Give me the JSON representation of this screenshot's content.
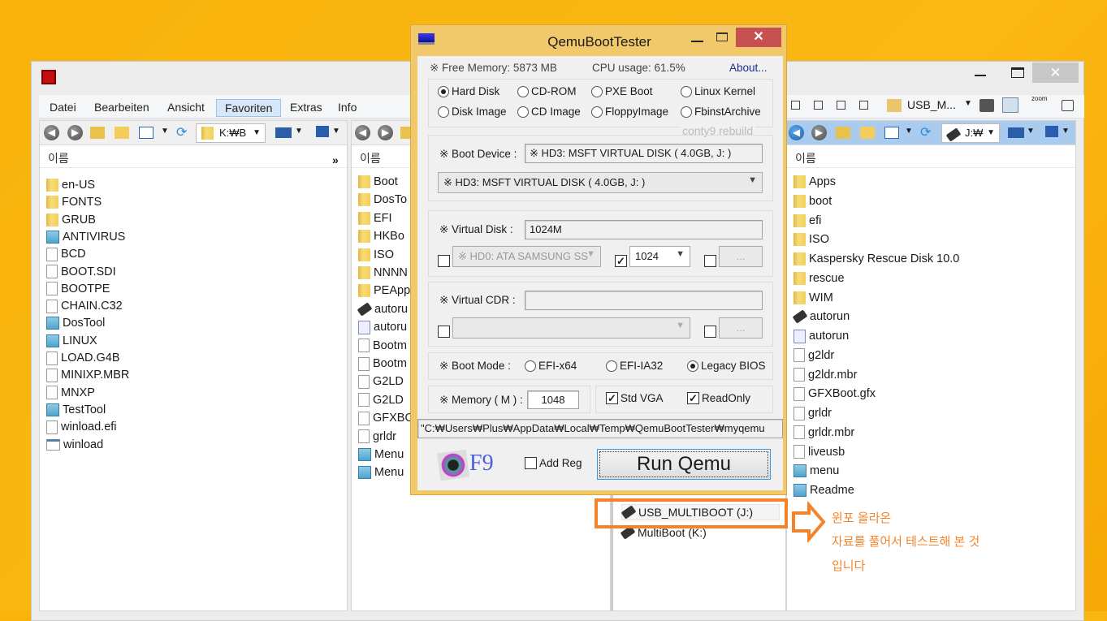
{
  "explorer": {
    "menu": [
      "Datei",
      "Bearbeiten",
      "Ansicht",
      "Favoriten",
      "Extras",
      "Info"
    ],
    "selected_menu": "Favoriten",
    "left_panel": {
      "path": "K:₩B",
      "column": "이름",
      "items": [
        {
          "name": "en-US",
          "icon": "folder"
        },
        {
          "name": "FONTS",
          "icon": "folder"
        },
        {
          "name": "GRUB",
          "icon": "folder"
        },
        {
          "name": "ANTIVIRUS",
          "icon": "notepad"
        },
        {
          "name": "BCD",
          "icon": "file"
        },
        {
          "name": "BOOT.SDI",
          "icon": "file"
        },
        {
          "name": "BOOTPE",
          "icon": "file"
        },
        {
          "name": "CHAIN.C32",
          "icon": "file"
        },
        {
          "name": "DosTool",
          "icon": "notepad"
        },
        {
          "name": "LINUX",
          "icon": "notepad"
        },
        {
          "name": "LOAD.G4B",
          "icon": "file"
        },
        {
          "name": "MINIXP.MBR",
          "icon": "file"
        },
        {
          "name": "MNXP",
          "icon": "file"
        },
        {
          "name": "TestTool",
          "icon": "notepad"
        },
        {
          "name": "winload.efi",
          "icon": "file"
        },
        {
          "name": "winload",
          "icon": "window"
        }
      ]
    },
    "middle_panel": {
      "column": "이름",
      "items": [
        {
          "name": "Boot",
          "icon": "folder"
        },
        {
          "name": "DosTo",
          "icon": "folder"
        },
        {
          "name": "EFI",
          "icon": "folder"
        },
        {
          "name": "HKBo",
          "icon": "folder"
        },
        {
          "name": "ISO",
          "icon": "folder"
        },
        {
          "name": "NNNN",
          "icon": "folder"
        },
        {
          "name": "PEApp",
          "icon": "folder"
        },
        {
          "name": "autoru",
          "icon": "usb"
        },
        {
          "name": "autoru",
          "icon": "gear"
        },
        {
          "name": "Bootm",
          "icon": "file"
        },
        {
          "name": "Bootm",
          "icon": "file"
        },
        {
          "name": "G2LD",
          "icon": "file"
        },
        {
          "name": "G2LD",
          "icon": "file"
        },
        {
          "name": "GFXBO",
          "icon": "file"
        },
        {
          "name": "grldr",
          "icon": "file"
        },
        {
          "name": "Menu",
          "icon": "notepad"
        },
        {
          "name": "Menu",
          "icon": "notepad"
        }
      ]
    },
    "tree": {
      "items": [
        {
          "name": "USB_MULTIBOOT (J:)",
          "icon": "usb"
        },
        {
          "name": "MultiBoot (K:)",
          "icon": "usb"
        }
      ]
    },
    "right_panel": {
      "path": "J:₩",
      "drive_combo": "USB_M...",
      "zoom_label": "zoom",
      "column": "이름",
      "items": [
        {
          "name": "Apps",
          "icon": "folder"
        },
        {
          "name": "boot",
          "icon": "folder"
        },
        {
          "name": "efi",
          "icon": "folder"
        },
        {
          "name": "ISO",
          "icon": "folder"
        },
        {
          "name": "Kaspersky Rescue Disk 10.0",
          "icon": "folder"
        },
        {
          "name": "rescue",
          "icon": "folder"
        },
        {
          "name": "WIM",
          "icon": "folder"
        },
        {
          "name": "autorun",
          "icon": "usb"
        },
        {
          "name": "autorun",
          "icon": "gear"
        },
        {
          "name": "g2ldr",
          "icon": "file"
        },
        {
          "name": "g2ldr.mbr",
          "icon": "file"
        },
        {
          "name": "GFXBoot.gfx",
          "icon": "file"
        },
        {
          "name": "grldr",
          "icon": "file"
        },
        {
          "name": "grldr.mbr",
          "icon": "file"
        },
        {
          "name": "liveusb",
          "icon": "file"
        },
        {
          "name": "menu",
          "icon": "notepad"
        },
        {
          "name": "Readme",
          "icon": "notepad"
        }
      ]
    }
  },
  "dialog": {
    "title": "QemuBootTester",
    "free_memory": "※ Free Memory: 5873 MB",
    "cpu_usage": "CPU usage: 61.5%",
    "about": "About...",
    "boot_types": [
      {
        "label": "Hard Disk",
        "checked": true
      },
      {
        "label": "CD-ROM",
        "checked": false
      },
      {
        "label": "PXE Boot",
        "checked": false
      },
      {
        "label": "Linux Kernel",
        "checked": false
      },
      {
        "label": "Disk Image",
        "checked": false
      },
      {
        "label": "CD Image",
        "checked": false
      },
      {
        "label": "FloppyImage",
        "checked": false
      },
      {
        "label": "FbinstArchive",
        "checked": false
      }
    ],
    "rebuild_label": "conty9 rebuild",
    "boot_device_label": "※ Boot Device :",
    "boot_device_value": "※ HD3: MSFT VIRTUAL DISK ( 4.0GB,  J: )",
    "boot_device_select": "※ HD3: MSFT VIRTUAL DISK ( 4.0GB,  J: )",
    "virtual_disk_label": "※ Virtual Disk :",
    "virtual_disk_value": "1024M",
    "vdisk_device_select": "※ HD0: ATA SAMSUNG SS",
    "vdisk_size_select": "1024",
    "browse_label": "...",
    "virtual_cdr_label": "※ Virtual CDR :",
    "virtual_cdr_value": "",
    "boot_mode_label": "※ Boot Mode :",
    "boot_modes": [
      {
        "label": "EFI-x64",
        "checked": false
      },
      {
        "label": "EFI-IA32",
        "checked": false
      },
      {
        "label": "Legacy BIOS",
        "checked": true
      }
    ],
    "memory_label": "※ Memory ( M ) :",
    "memory_value": "1048",
    "std_vga": "Std VGA",
    "readonly": "ReadOnly",
    "command_path": "\"C:₩Users₩Plus₩AppData₩Local₩Temp₩QemuBootTester₩myqemu",
    "f9_label": "F9",
    "add_reg": "Add Reg",
    "run_button": "Run Qemu"
  },
  "annotation": {
    "lines": [
      "윈포 올라온",
      "자료를 풀어서 테스트해 본 것",
      " 입니다"
    ],
    "color": "#f5832a"
  }
}
